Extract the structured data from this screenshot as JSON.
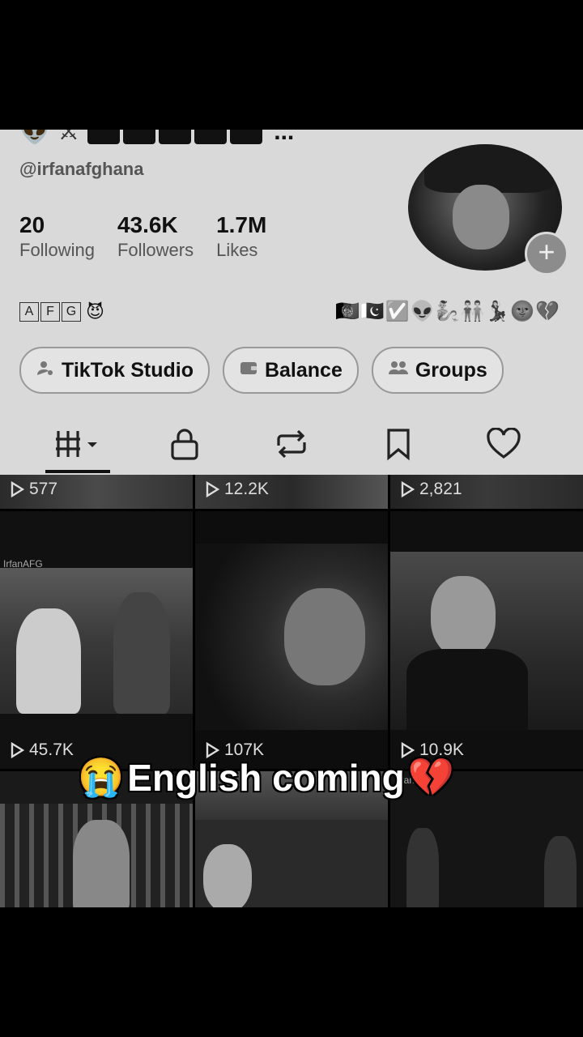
{
  "profile": {
    "handle": "@irfanafghana",
    "name_suffix": "...",
    "stats": [
      {
        "value": "20",
        "label": "Following"
      },
      {
        "value": "43.6K",
        "label": "Followers"
      },
      {
        "value": "1.7M",
        "label": "Likes"
      }
    ],
    "bio_letters": [
      "A",
      "F",
      "G"
    ],
    "bio_right_emojis": "🇦🇫🇵🇰✅👽🧞👬💃🌚💔"
  },
  "buttons": [
    {
      "label": "TikTok Studio",
      "icon": "user-gear-icon"
    },
    {
      "label": "Balance",
      "icon": "wallet-icon"
    },
    {
      "label": "Groups",
      "icon": "groups-icon"
    }
  ],
  "tabs": [
    "videos-grid-icon",
    "lock-icon",
    "repost-icon",
    "bookmark-icon",
    "heart-icon"
  ],
  "videos": [
    {
      "views": "577"
    },
    {
      "views": "12.2K"
    },
    {
      "views": "2,821"
    },
    {
      "views": "45.7K",
      "watermark": "IrfanAFG"
    },
    {
      "views": "107K"
    },
    {
      "views": "10.9K"
    },
    {
      "views": ""
    },
    {
      "views": ""
    },
    {
      "views": "",
      "watermark": "IrfanAFG"
    }
  ],
  "overlay": {
    "text": "English coming",
    "left_emoji": "😭",
    "right_emoji": "💔"
  }
}
